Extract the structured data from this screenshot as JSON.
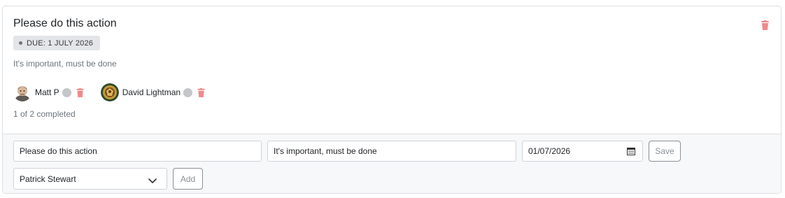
{
  "action": {
    "title": "Please do this action",
    "due_badge": "DUE: 1 JULY 2026",
    "description": "It's important, must be done",
    "progress_text": "1 of 2 completed",
    "assignees": [
      {
        "name": "Matt P",
        "status": "incomplete"
      },
      {
        "name": "David Lightman",
        "status": "incomplete"
      }
    ]
  },
  "edit_form": {
    "title_value": "Please do this action",
    "description_value": "It's important, must be done",
    "date_value": "01/07/2026",
    "save_label": "Save",
    "assignee_select_value": "Patrick Stewart",
    "add_label": "Add"
  },
  "colors": {
    "delete_icon": "#f08a8a",
    "badge_bg": "#e3e5e8",
    "status_dot": "#c4c6c9",
    "form_bg": "#f7f8f9"
  },
  "icons": {
    "delete": "trash-icon",
    "calendar": "calendar-icon",
    "dropdown": "chevron-down-icon"
  }
}
